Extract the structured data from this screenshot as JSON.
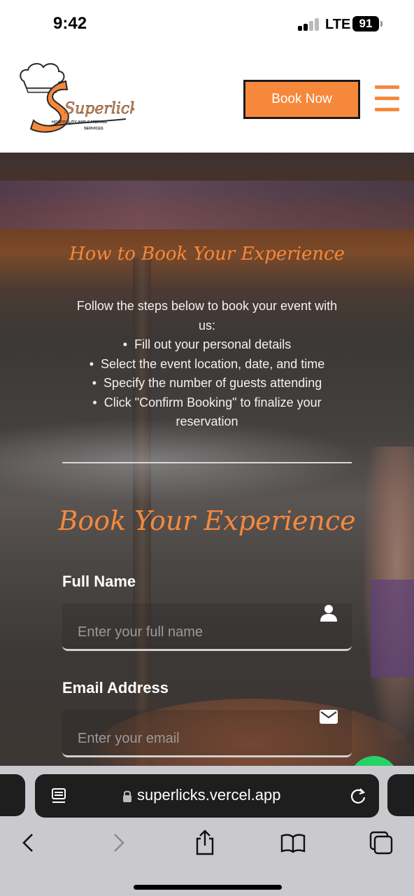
{
  "status_bar": {
    "time": "9:42",
    "network": "LTE",
    "battery": "91"
  },
  "header": {
    "logo_name": "Superlicks",
    "logo_tagline": "HOSPITALITY AND CATERING",
    "logo_tagline2": "SERVICES",
    "book_now_label": "Book Now"
  },
  "how_section": {
    "title": "How to Book Your Experience",
    "intro": "Follow the steps below to book your event with us:",
    "steps": [
      "Fill out your personal details",
      "Select the event location, date, and time",
      "Specify the number of guests attending",
      "Click \"Confirm Booking\" to finalize your reservation"
    ]
  },
  "form": {
    "title": "Book Your Experience",
    "full_name": {
      "label": "Full Name",
      "placeholder": "Enter your full name",
      "icon": "user-icon"
    },
    "email": {
      "label": "Email Address",
      "placeholder": "Enter your email",
      "icon": "envelope-icon"
    }
  },
  "browser": {
    "url": "superlicks.vercel.app"
  },
  "colors": {
    "accent": "#f6883c",
    "overlay": "#3e3a38"
  }
}
